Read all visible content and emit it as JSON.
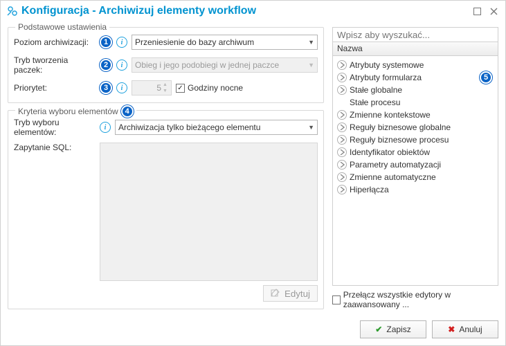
{
  "titlebar": {
    "title": "Konfiguracja - Archiwizuj elementy workflow"
  },
  "groups": {
    "basic": {
      "title": "Podstawowe ustawienia"
    },
    "criteria": {
      "title": "Kryteria wyboru elementów"
    }
  },
  "labels": {
    "archiveLevel": "Poziom archiwizacji:",
    "packMode": "Tryb tworzenia paczek:",
    "priority": "Priorytet:",
    "nightHours": "Godziny nocne",
    "selectMode": "Tryb wyboru elementów:",
    "sqlQuery": "Zapytanie SQL:"
  },
  "values": {
    "archiveLevel": "Przeniesienie do bazy archiwum",
    "packMode": "Obieg i jego podobiegi w jednej paczce",
    "priority": "5",
    "nightHoursChecked": true,
    "selectMode": "Archiwizacja tylko bieżącego elementu"
  },
  "badges": {
    "b1": "1",
    "b2": "2",
    "b3": "3",
    "b4": "4",
    "b5": "5"
  },
  "buttons": {
    "edit": "Edytuj",
    "save": "Zapisz",
    "cancel": "Anuluj"
  },
  "right": {
    "searchPlaceholder": "Wpisz aby wyszukać...",
    "header": "Nazwa",
    "items": [
      {
        "label": "Atrybuty systemowe",
        "exp": true
      },
      {
        "label": "Atrybuty formularza",
        "exp": true
      },
      {
        "label": "Stałe globalne",
        "exp": true
      },
      {
        "label": "Stałe procesu",
        "exp": false
      },
      {
        "label": "Zmienne kontekstowe",
        "exp": true
      },
      {
        "label": "Reguły biznesowe globalne",
        "exp": true
      },
      {
        "label": "Reguły biznesowe procesu",
        "exp": true
      },
      {
        "label": "Identyfikator obiektów",
        "exp": true
      },
      {
        "label": "Parametry automatyzacji",
        "exp": true
      },
      {
        "label": "Zmienne automatyczne",
        "exp": true
      },
      {
        "label": "Hiperłącza",
        "exp": true
      }
    ],
    "advancedToggle": "Przełącz wszystkie edytory w zaawansowany ..."
  }
}
